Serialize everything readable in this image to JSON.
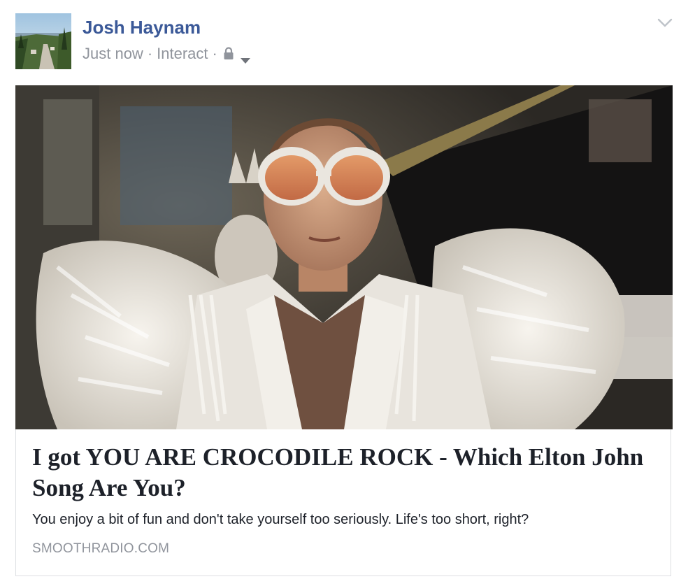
{
  "post": {
    "author": "Josh Haynam",
    "timestamp": "Just now",
    "app": "Interact",
    "separator": "·",
    "privacy_icon": "lock-icon",
    "audience_icon": "caret-down-icon",
    "options_icon": "chevron-down-icon"
  },
  "share": {
    "title": "I got YOU ARE CROCODILE ROCK - Which Elton John Song Are You?",
    "description": "You enjoy a bit of fun and don't take yourself too seriously. Life's too short, right?",
    "domain": "SMOOTHRADIO.COM"
  },
  "colors": {
    "author_link": "#3b5998",
    "meta_gray": "#90949c",
    "text_dark": "#1d2129",
    "card_border": "#dddfe2"
  }
}
